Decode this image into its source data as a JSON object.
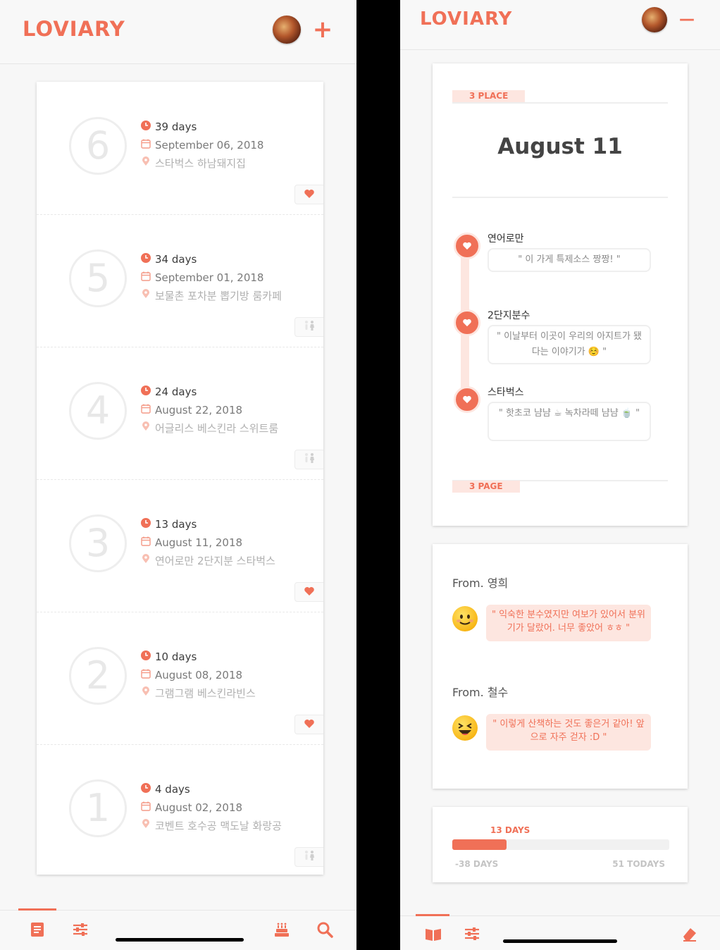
{
  "left_screen": {
    "logo": "LOVIARY",
    "add_button": "+",
    "entries": [
      {
        "number": "6",
        "days": "39 days",
        "date": "September 06, 2018",
        "place": "스타벅스 하남돼지집",
        "reaction": "heart"
      },
      {
        "number": "5",
        "days": "34 days",
        "date": "September 01, 2018",
        "place": "보물촌 포차분 뽑기방 룸카페",
        "reaction": "couple"
      },
      {
        "number": "4",
        "days": "24 days",
        "date": "August 22, 2018",
        "place": "어글리스 베스킨라 스위트룸",
        "reaction": "couple"
      },
      {
        "number": "3",
        "days": "13 days",
        "date": "August 11, 2018",
        "place": "연어로만 2단지분 스타벅스",
        "reaction": "heart"
      },
      {
        "number": "2",
        "days": "10 days",
        "date": "August 08, 2018",
        "place": "그램그램 베스킨라빈스",
        "reaction": "heart"
      },
      {
        "number": "1",
        "days": "4 days",
        "date": "August 02, 2018",
        "place": "코벤트 호수공 맥도날 화랑공",
        "reaction": "couple"
      }
    ],
    "tabs": [
      "diary-icon",
      "sliders-icon",
      "cake-icon",
      "search-icon"
    ]
  },
  "right_screen": {
    "logo": "LOVIARY",
    "collapse_button": "—",
    "place_tag": "3 PLACE",
    "date_title": "August 11",
    "timeline": [
      {
        "name": "연어로만",
        "comment": "\" 이 가게 특제소스 짱짱! \""
      },
      {
        "name": "2단지분수",
        "comment": "\" 이날부터 이곳이 우리의 아지트가 됐다는 이야기가 ☺️ \""
      },
      {
        "name": "스타벅스",
        "comment": "\" 핫초코 냠냠 ☕ 녹차라떼 냠냠 🍵 \""
      }
    ],
    "page_tag": "3 PAGE",
    "messages": [
      {
        "from": "From. 영희",
        "emoji": "smiling-face-icon",
        "text": "\" 익숙한 분수였지만 여보가 있어서 분위기가 달랐어. 너무 좋았어 ㅎㅎ \""
      },
      {
        "from": "From. 철수",
        "emoji": "laughing-face-icon",
        "text": "\" 이렇게 산책하는 것도 좋은거 같아! 앞으로 자주 걷자 :D \""
      }
    ],
    "progress": {
      "current": "13 DAYS",
      "start": "-38 DAYS",
      "end": "51 TODAYS",
      "fraction": 0.25
    },
    "tabs": [
      "book-icon",
      "sliders-icon",
      "eraser-icon"
    ]
  },
  "colors": {
    "accent": "#f07057",
    "accent_light": "#fde6e0",
    "background": "#f7f7f7"
  }
}
